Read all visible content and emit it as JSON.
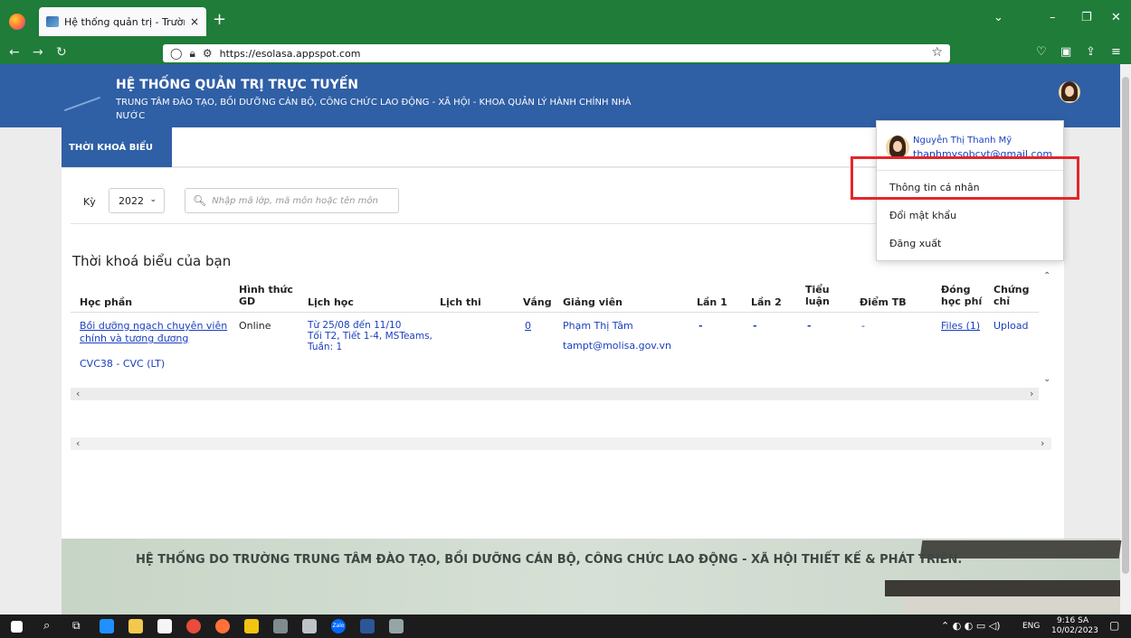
{
  "browser": {
    "tab_title": "Hệ thống quản trị - Trường Đào",
    "tab_close": "×",
    "new_tab": "+",
    "url": "https://esolasa.appspot.com",
    "win_chevron": "⌄",
    "win_min": "–",
    "win_max": "❐",
    "win_close": "✕"
  },
  "header": {
    "title": "HỆ THỐNG QUẢN TRỊ TRỰC TUYẾN",
    "subtitle": "TRUNG TÂM ĐÀO TẠO, BỒI DƯỠNG CÁN BỘ, CÔNG CHỨC LAO ĐỘNG - XÃ HỘI - KHOA QUẢN LÝ HÀNH CHÍNH NHÀ NƯỚC"
  },
  "menu": {
    "active_item": "THỜI KHOÁ BIỂU"
  },
  "filter": {
    "ky_label": "Kỳ",
    "ky_value": "2022",
    "search_placeholder": "Nhập mã lớp, mã môn hoặc tên môn"
  },
  "section_title": "Thời khoá biểu của bạn",
  "table": {
    "headers": {
      "hoc_phan": "Học phần",
      "hinh_thuc_1": "Hình thức",
      "hinh_thuc_2": "GD",
      "lich_hoc": "Lịch học",
      "lich_thi": "Lịch thi",
      "vang": "Vắng",
      "giang_vien": "Giảng viên",
      "lan1": "Lần 1",
      "lan2": "Lần 2",
      "tieu_luan_1": "Tiểu",
      "tieu_luan_2": "luận",
      "diem_tb": "Điểm TB",
      "dong_hoc_phi_1": "Đóng",
      "dong_hoc_phi_2": "học phí",
      "chung_chi_1": "Chứng",
      "chung_chi_2": "chỉ"
    },
    "rows": [
      {
        "hoc_phan_1": "Bồi dưỡng ngạch chuyên viên",
        "hoc_phan_2": "chính và tương đương",
        "ma": "CVC38 - CVC (LT)",
        "hinh_thuc": "Online",
        "lich_hoc_1": "Từ 25/08 đến 11/10",
        "lich_hoc_2": "Tối T2, Tiết 1-4, MSTeams,",
        "lich_hoc_3": "Tuần: 1",
        "vang": "0",
        "giang_vien": "Phạm Thị Tâm",
        "email": "tampt@molisa.gov.vn",
        "lan1": "-",
        "lan2": "-",
        "tieu_luan": "-",
        "diem_tb": "-",
        "dong_hoc_phi": "Files (1)",
        "chung_chi": "Upload"
      }
    ]
  },
  "dropdown": {
    "user_name": "Nguyễn Thị Thanh Mỹ",
    "user_email": "thanhmysobcvt@gmail.com",
    "items": [
      "Thông tin cá nhân",
      "Đổi mật khẩu",
      "Đăng xuất"
    ]
  },
  "footer": {
    "text": "HỆ THỐNG DO TRƯỜNG TRUNG TÂM ĐÀO TẠO, BỒI DƯỠNG CÁN BỘ, CÔNG CHỨC LAO ĐỘNG - XÃ HỘI THIẾT KẾ & PHÁT TRIỂN."
  },
  "taskbar": {
    "lang": "ENG",
    "time": "9:16 SA",
    "date": "10/02/2023",
    "zalo": "Zalo"
  },
  "colors": {
    "browser_green": "#1f7c39",
    "header_blue": "#2f5fa5",
    "link_blue": "#1a3fbf",
    "highlight_red": "#e3262b"
  }
}
